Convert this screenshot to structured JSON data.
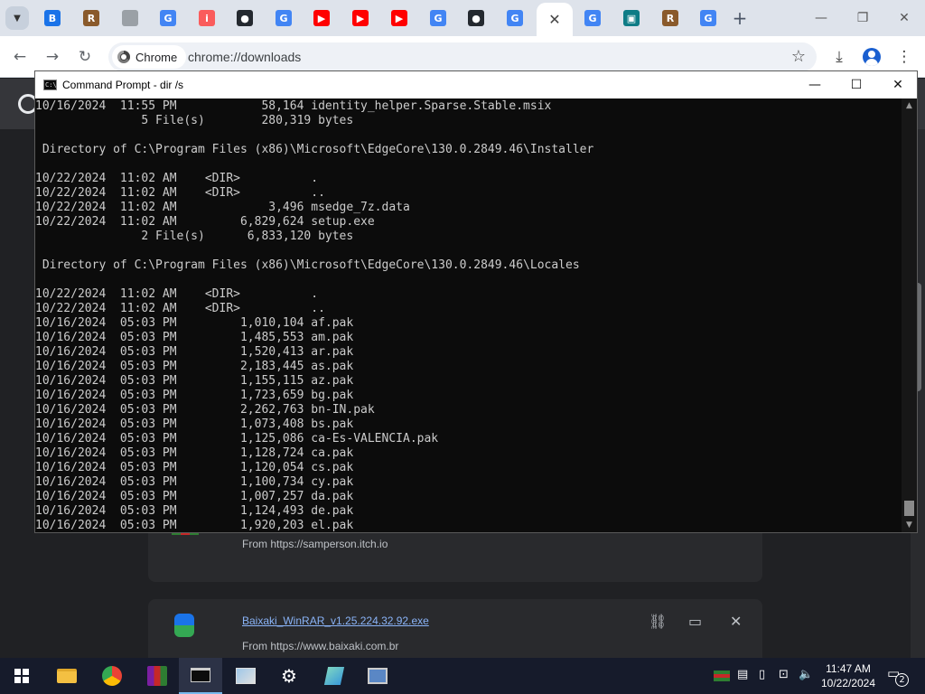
{
  "browser": {
    "tabs": [
      {
        "icon": "baixaki-favicon",
        "color": "#1a73e8",
        "glyph": "B"
      },
      {
        "icon": "winrar-favicon",
        "color": "#8a5a2b",
        "glyph": "R"
      },
      {
        "icon": "loading-favicon",
        "color": "#9aa0a6",
        "glyph": ""
      },
      {
        "icon": "google-favicon",
        "color": "#4285f4",
        "glyph": "G"
      },
      {
        "icon": "itch-favicon",
        "color": "#fa5c5c",
        "glyph": "i"
      },
      {
        "icon": "github-favicon",
        "color": "#24292f",
        "glyph": "●"
      },
      {
        "icon": "google-favicon",
        "color": "#4285f4",
        "glyph": "G"
      },
      {
        "icon": "youtube-favicon",
        "color": "#ff0000",
        "glyph": "▶"
      },
      {
        "icon": "youtube-favicon",
        "color": "#ff0000",
        "glyph": "▶"
      },
      {
        "icon": "youtube-favicon",
        "color": "#ff0000",
        "glyph": "▶"
      },
      {
        "icon": "google-favicon",
        "color": "#4285f4",
        "glyph": "G"
      },
      {
        "icon": "github-favicon",
        "color": "#24292f",
        "glyph": "●"
      },
      {
        "icon": "google-favicon",
        "color": "#4285f4",
        "glyph": "G"
      },
      {
        "icon": "close-icon",
        "color": "#444444",
        "glyph": "✕",
        "active": true
      },
      {
        "icon": "google-favicon",
        "color": "#4285f4",
        "glyph": "G"
      },
      {
        "icon": "app-favicon",
        "color": "#0e7c86",
        "glyph": "▣"
      },
      {
        "icon": "winrar-favicon",
        "color": "#8a5a2b",
        "glyph": "R"
      },
      {
        "icon": "google-favicon",
        "color": "#4285f4",
        "glyph": "G"
      }
    ],
    "site_chip": "Chrome",
    "url": "chrome://downloads"
  },
  "downloads": {
    "item1": {
      "from": "From https://samperson.itch.io"
    },
    "item2": {
      "filename": "Baixaki_WinRAR_v1.25.224.32.92.exe",
      "from": "From https://www.baixaki.com.br"
    }
  },
  "cmd": {
    "title": "Command Prompt - dir  /s",
    "lines": [
      "10/16/2024  11:55 PM            58,164 identity_helper.Sparse.Stable.msix",
      "               5 File(s)        280,319 bytes",
      "",
      " Directory of C:\\Program Files (x86)\\Microsoft\\EdgeCore\\130.0.2849.46\\Installer",
      "",
      "10/22/2024  11:02 AM    <DIR>          .",
      "10/22/2024  11:02 AM    <DIR>          ..",
      "10/22/2024  11:02 AM             3,496 msedge_7z.data",
      "10/22/2024  11:02 AM         6,829,624 setup.exe",
      "               2 File(s)      6,833,120 bytes",
      "",
      " Directory of C:\\Program Files (x86)\\Microsoft\\EdgeCore\\130.0.2849.46\\Locales",
      "",
      "10/22/2024  11:02 AM    <DIR>          .",
      "10/22/2024  11:02 AM    <DIR>          ..",
      "10/16/2024  05:03 PM         1,010,104 af.pak",
      "10/16/2024  05:03 PM         1,485,553 am.pak",
      "10/16/2024  05:03 PM         1,520,413 ar.pak",
      "10/16/2024  05:03 PM         2,183,445 as.pak",
      "10/16/2024  05:03 PM         1,155,115 az.pak",
      "10/16/2024  05:03 PM         1,723,659 bg.pak",
      "10/16/2024  05:03 PM         2,262,763 bn-IN.pak",
      "10/16/2024  05:03 PM         1,073,408 bs.pak",
      "10/16/2024  05:03 PM         1,125,086 ca-Es-VALENCIA.pak",
      "10/16/2024  05:03 PM         1,128,724 ca.pak",
      "10/16/2024  05:03 PM         1,120,054 cs.pak",
      "10/16/2024  05:03 PM         1,100,734 cy.pak",
      "10/16/2024  05:03 PM         1,007,257 da.pak",
      "10/16/2024  05:03 PM         1,124,493 de.pak",
      "10/16/2024  05:03 PM         1,920,203 el.pak"
    ]
  },
  "taskbar": {
    "apps": [
      "file-explorer",
      "chrome",
      "winrar",
      "command-prompt",
      "photos",
      "settings",
      "notepad",
      "network-tool"
    ],
    "time": "11:47 AM",
    "date": "10/22/2024",
    "notifications": "2"
  }
}
